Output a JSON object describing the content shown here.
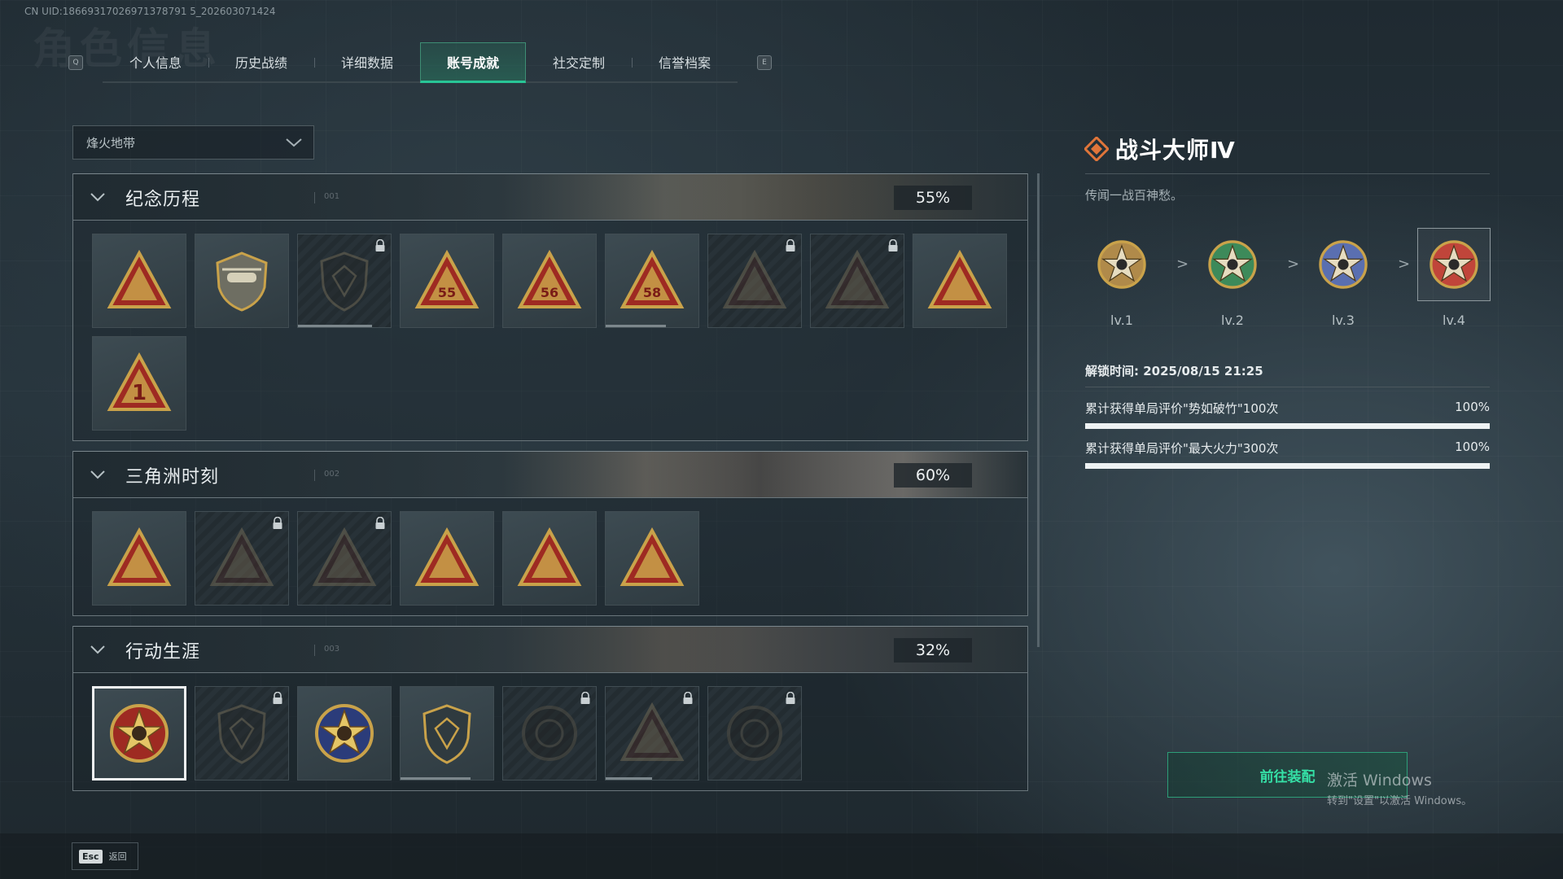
{
  "uid": "CN UID:18669317026971378791 5_202603071424",
  "tabs": {
    "prev_key": "Q",
    "next_key": "E",
    "items": [
      "个人信息",
      "历史战绩",
      "详细数据",
      "账号成就",
      "社交定制",
      "信誉档案"
    ],
    "active_index": 3
  },
  "filter": {
    "selected": "烽火地带"
  },
  "sections": [
    {
      "title": "纪念历程",
      "code": "001",
      "percent": "55%",
      "badges": [
        {
          "icon": "mountain-triangle-badge",
          "locked": false
        },
        {
          "icon": "helicopter-shield-badge",
          "locked": false
        },
        {
          "icon": "dark-shield-badge",
          "locked": true,
          "progress": 0.8
        },
        {
          "icon": "season-55-badge",
          "locked": false,
          "label": "55"
        },
        {
          "icon": "season-56-badge",
          "locked": false,
          "label": "56"
        },
        {
          "icon": "season-58-badge",
          "locked": false,
          "label": "58",
          "progress": 0.65
        },
        {
          "icon": "soldier-triangle-badge",
          "locked": true
        },
        {
          "icon": "skull-blades-badge",
          "locked": true
        },
        {
          "icon": "cloud-triangle-badge",
          "locked": false
        },
        {
          "icon": "number-one-badge",
          "locked": false,
          "label": "1"
        }
      ]
    },
    {
      "title": "三角洲时刻",
      "code": "002",
      "percent": "60%",
      "badges": [
        {
          "icon": "robot-triangle-badge",
          "locked": false
        },
        {
          "icon": "vehicle-triangle-badge",
          "locked": true
        },
        {
          "icon": "kneeling-figure-badge",
          "locked": true
        },
        {
          "icon": "gem-triangle-badge",
          "locked": false
        },
        {
          "icon": "team-triangle-badge",
          "locked": false
        },
        {
          "icon": "rocket-triangle-badge",
          "locked": false
        }
      ]
    },
    {
      "title": "行动生涯",
      "code": "003",
      "percent": "32%",
      "badges": [
        {
          "icon": "battle-master-star-badge",
          "locked": false,
          "selected": true
        },
        {
          "icon": "chevron-shield-badge",
          "locked": true
        },
        {
          "icon": "stars-crest-badge",
          "locked": false
        },
        {
          "icon": "crystal-shield-badge",
          "locked": false,
          "progress": 0.75
        },
        {
          "icon": "helmet-circle-badge",
          "locked": true
        },
        {
          "icon": "crosshair-skull-badge",
          "locked": true,
          "progress": 0.5
        },
        {
          "icon": "eye-circle-badge",
          "locked": true
        }
      ]
    }
  ],
  "detail": {
    "title": "战斗大师Ⅳ",
    "description": "传闻一战百神愁。",
    "levels": [
      {
        "label": "lv.1",
        "color": "#b08a4a"
      },
      {
        "label": "lv.2",
        "color": "#3d8a5a"
      },
      {
        "label": "lv.3",
        "color": "#5a6fb0"
      },
      {
        "label": "lv.4",
        "color": "#c0453a"
      }
    ],
    "level_separator": ">",
    "unlock_time": "解锁时间: 2025/08/15 21:25",
    "requirements": [
      {
        "text": "累计获得单局评价\"势如破竹\"100次",
        "percent_text": "100%",
        "progress": 1.0
      },
      {
        "text": "累计获得单局评价\"最大火力\"300次",
        "percent_text": "100%",
        "progress": 1.0
      }
    ],
    "equip_button": "前往装配"
  },
  "windows_activation": {
    "line1": "激活 Windows",
    "line2": "转到\"设置\"以激活 Windows。"
  },
  "footer": {
    "esc_key": "Esc",
    "esc_label": "返回"
  },
  "colors": {
    "accent_green": "#28c596",
    "badge_gold": "#c9a24a",
    "badge_red": "#9e2a22"
  }
}
